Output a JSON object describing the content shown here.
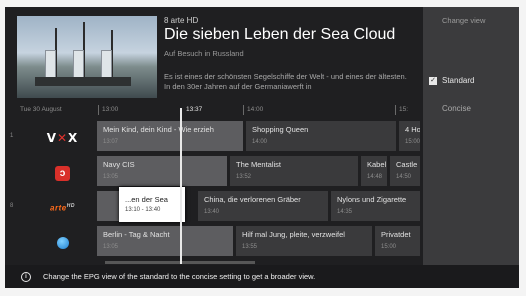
{
  "header": {
    "channel_line": "8 arte HD",
    "title": "Die sieben Leben der Sea Cloud",
    "subtitle": "Auf Besuch in Russland",
    "description": "Es ist eines der schönsten Segelschiffe der Welt - und eines der ältesten. In den 30er Jahren auf der Germaniawerft in"
  },
  "timeline": {
    "date": "Tue 30 August",
    "times": [
      "13:00",
      "13:37",
      "14:00",
      "15:"
    ]
  },
  "rows": [
    {
      "number": "1",
      "logo": "VOX",
      "programs": [
        {
          "title": "Mein Kind, dein Kind - Wie erzieh",
          "time": "13:07"
        },
        {
          "title": "Shopping Queen",
          "time": "14:00"
        },
        {
          "title": "4 Hoc",
          "time": "15:00"
        }
      ]
    },
    {
      "number": "",
      "logo": "RTL",
      "programs": [
        {
          "title": "Navy CIS",
          "time": "13:05"
        },
        {
          "title": "The Mentalist",
          "time": "13:52"
        },
        {
          "title": "Kabel",
          "time": "14:48"
        },
        {
          "title": "Castle",
          "time": "14:50"
        }
      ]
    },
    {
      "number": "8",
      "logo": "arte HD",
      "programs": [
        {
          "title": "...en der Sea",
          "time": "13:10 - 13:40"
        },
        {
          "title": "China, die verlorenen Gräber",
          "time": "13:40"
        },
        {
          "title": "Nylons und Zigarette",
          "time": "14:35"
        }
      ]
    },
    {
      "number": "",
      "logo": "ZDF",
      "programs": [
        {
          "title": "Berlin - Tag & Nacht",
          "time": "13:05"
        },
        {
          "title": "Hilf mal Jung, pleite, verzweifel",
          "time": "13:55"
        },
        {
          "title": "Privatdet",
          "time": "15:00"
        }
      ]
    }
  ],
  "side_panel": {
    "title": "Change view",
    "options": [
      {
        "label": "Standard",
        "checked": true
      },
      {
        "label": "Concise",
        "checked": false
      }
    ]
  },
  "tip": {
    "icon": "info-icon",
    "text": "Change the EPG view of the standard to the concise setting to get a broader view."
  }
}
